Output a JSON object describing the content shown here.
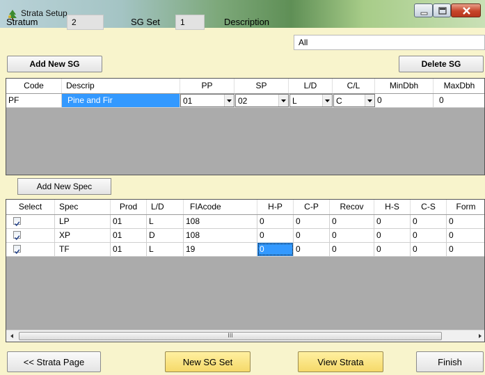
{
  "window": {
    "title": "Strata Setup"
  },
  "header": {
    "stratum_label": "Stratum",
    "stratum_value": "2",
    "sgset_label": "SG Set",
    "sgset_value": "1",
    "description_label": "Description",
    "description_value": "All"
  },
  "sg_buttons": {
    "add": "Add New SG",
    "delete": "Delete SG"
  },
  "sg_grid": {
    "columns": [
      "Code",
      "Descrip",
      "PP",
      "SP",
      "L/D",
      "C/L",
      "MinDbh",
      "MaxDbh"
    ],
    "rows": [
      {
        "code": "PF",
        "descrip": "Pine and Fir",
        "pp": "01",
        "sp": "02",
        "ld": "L",
        "cl": "C",
        "mindbh": "0",
        "maxdbh": "0"
      }
    ]
  },
  "spec_button": {
    "add": "Add New Spec"
  },
  "spec_grid": {
    "columns": [
      "Select",
      "Spec",
      "Prod",
      "L/D",
      "FIAcode",
      "H-P",
      "C-P",
      "Recov",
      "H-S",
      "C-S",
      "Form"
    ],
    "rows": [
      {
        "checked": true,
        "spec": "LP",
        "prod": "01",
        "ld": "L",
        "fia": "108",
        "hp": "0",
        "cp": "0",
        "recov": "0",
        "hs": "0",
        "cs": "0",
        "form": "0"
      },
      {
        "checked": true,
        "spec": "XP",
        "prod": "01",
        "ld": "D",
        "fia": "108",
        "hp": "0",
        "cp": "0",
        "recov": "0",
        "hs": "0",
        "cs": "0",
        "form": "0"
      },
      {
        "checked": true,
        "spec": "TF",
        "prod": "01",
        "ld": "L",
        "fia": "19",
        "hp": "0",
        "cp": "0",
        "recov": "0",
        "hs": "0",
        "cs": "0",
        "form": "0"
      }
    ],
    "scroll_grip": "III"
  },
  "footer": {
    "strata_page": "<< Strata Page",
    "new_sg_set": "New SG Set",
    "view_strata": "View Strata",
    "finish": "Finish"
  },
  "colors": {
    "form_bg": "#f8f4cc",
    "selection": "#3399ff",
    "accent_button": "#f5d96a"
  },
  "icons": [
    "tree-app-icon",
    "minimize-icon",
    "maximize-icon",
    "close-icon",
    "checkbox-checked-icon",
    "dropdown-arrow-icon",
    "scroll-left-icon",
    "scroll-right-icon"
  ]
}
